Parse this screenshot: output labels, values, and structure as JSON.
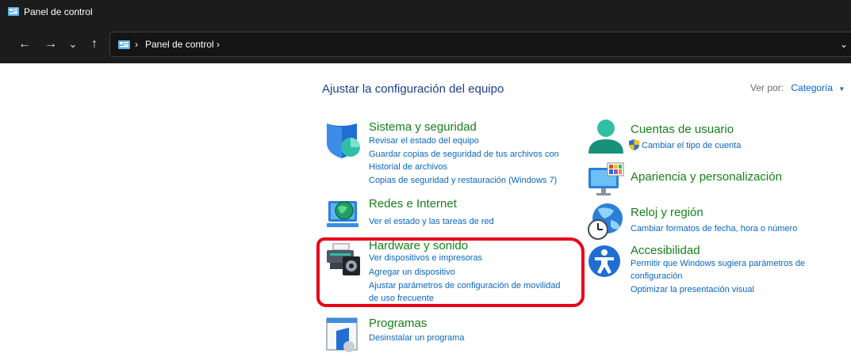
{
  "window": {
    "title": "Panel de control",
    "icon": "control-panel-icon"
  },
  "nav": {
    "back": "←",
    "forward": "→",
    "recent": "⌄",
    "up": "↑"
  },
  "address": {
    "icon": "control-panel-icon",
    "separator": "›",
    "crumbs": [
      "Panel de control"
    ],
    "dropdown": "⌄"
  },
  "main": {
    "heading": "Ajustar la configuración del equipo",
    "view_by_label": "Ver por:",
    "view_by_value": "Categoría",
    "left": [
      {
        "title": "Sistema y seguridad",
        "icon": "shield-icon",
        "links": [
          "Revisar el estado del equipo",
          "Guardar copias de seguridad de tus archivos con",
          "Historial de archivos",
          "Copias de seguridad y restauración (Windows 7)"
        ]
      },
      {
        "title": "Redes e Internet",
        "icon": "network-globe-icon",
        "links": [
          "Ver el estado y las tareas de red"
        ]
      },
      {
        "title": "Hardware y sonido",
        "icon": "printer-speaker-icon",
        "links": [
          "Ver dispositivos e impresoras",
          "Agregar un dispositivo",
          "Ajustar parámetros de configuración de movilidad",
          "de uso frecuente"
        ]
      },
      {
        "title": "Programas",
        "icon": "programs-icon",
        "links": [
          "Desinstalar un programa"
        ]
      }
    ],
    "right": [
      {
        "title": "Cuentas de usuario",
        "icon": "user-icon",
        "links": [
          "Cambiar el tipo de cuenta"
        ],
        "link_icon": "uac-shield-icon"
      },
      {
        "title": "Apariencia y personalización",
        "icon": "monitor-appearance-icon",
        "links": []
      },
      {
        "title": "Reloj y región",
        "icon": "clock-globe-icon",
        "links": [
          "Cambiar formatos de fecha, hora o número"
        ]
      },
      {
        "title": "Accesibilidad",
        "icon": "accessibility-icon",
        "links": [
          "Permitir que Windows sugiera parámetros de",
          "configuración",
          "Optimizar la presentación visual"
        ]
      }
    ]
  },
  "colors": {
    "title_bar": "#1c1c1c",
    "category_title": "#16801c",
    "link": "#0a66c2",
    "heading": "#1b3f8a",
    "annotation": "#e8001b"
  }
}
